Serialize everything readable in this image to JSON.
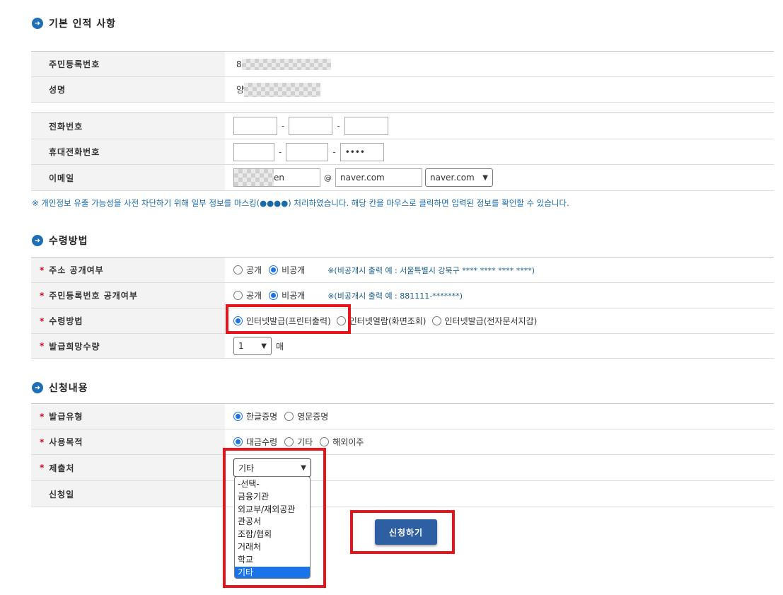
{
  "sections": {
    "basic": "기본 인적 사항",
    "receive": "수령방법",
    "apply": "신청내용"
  },
  "personal": {
    "rrn_label": "주민등록번호",
    "rrn_value": "8",
    "name_label": "성명",
    "name_value": "양"
  },
  "contact": {
    "phone_label": "전화번호",
    "mobile_label": "휴대전화번호",
    "mobile_last": "••••",
    "email_label": "이메일",
    "email_id_suffix": "en",
    "at": "@",
    "email_domain": "naver.com",
    "email_domain_select": "naver.com",
    "dash": "-"
  },
  "mask_notice": "※ 개인정보 유출 가능성을 사전 차단하기 위해 일부 정보를 마스킹(●●●●) 처리하였습니다. 해당 칸을 마우스로 클릭하면 입력된 정보를 확인할 수 있습니다.",
  "receive": {
    "addr_label": "주소 공개여부",
    "rrn_label": "주민등록번호 공개여부",
    "public": "공개",
    "private": "비공개",
    "addr_note": "※(비공개시 출력 예 : 서울특별시 강북구 **** **** **** ****)",
    "rrn_note": "※(비공개시 출력 예 : 881111-*******)",
    "method_label": "수령방법",
    "method_options": [
      "인터넷발급(프린터출력)",
      "인터넷열람(화면조회)",
      "인터넷발급(전자문서지갑)"
    ],
    "qty_label": "발급희망수량",
    "qty_value": "1",
    "qty_unit": "매"
  },
  "apply": {
    "type_label": "발급유형",
    "type_options": [
      "한글증명",
      "영문증명"
    ],
    "purpose_label": "사용목적",
    "purpose_options": [
      "대금수령",
      "기타",
      "해외이주"
    ],
    "submit_to_label": "제출처",
    "submit_to_value": "기타",
    "date_label": "신청일",
    "dropdown_options": [
      "-선택-",
      "금융기관",
      "외교부/재외공관",
      "관공서",
      "조합/협회",
      "거래처",
      "학교",
      "기타"
    ]
  },
  "submit_button": "신청하기",
  "required_mark": "*",
  "icons": {
    "section": "arrow-right-circle-icon",
    "chevron": "chevron-down-icon"
  },
  "colors": {
    "accent": "#1e6fb5",
    "highlight": "#e8141b",
    "button": "#2f5fa3"
  }
}
